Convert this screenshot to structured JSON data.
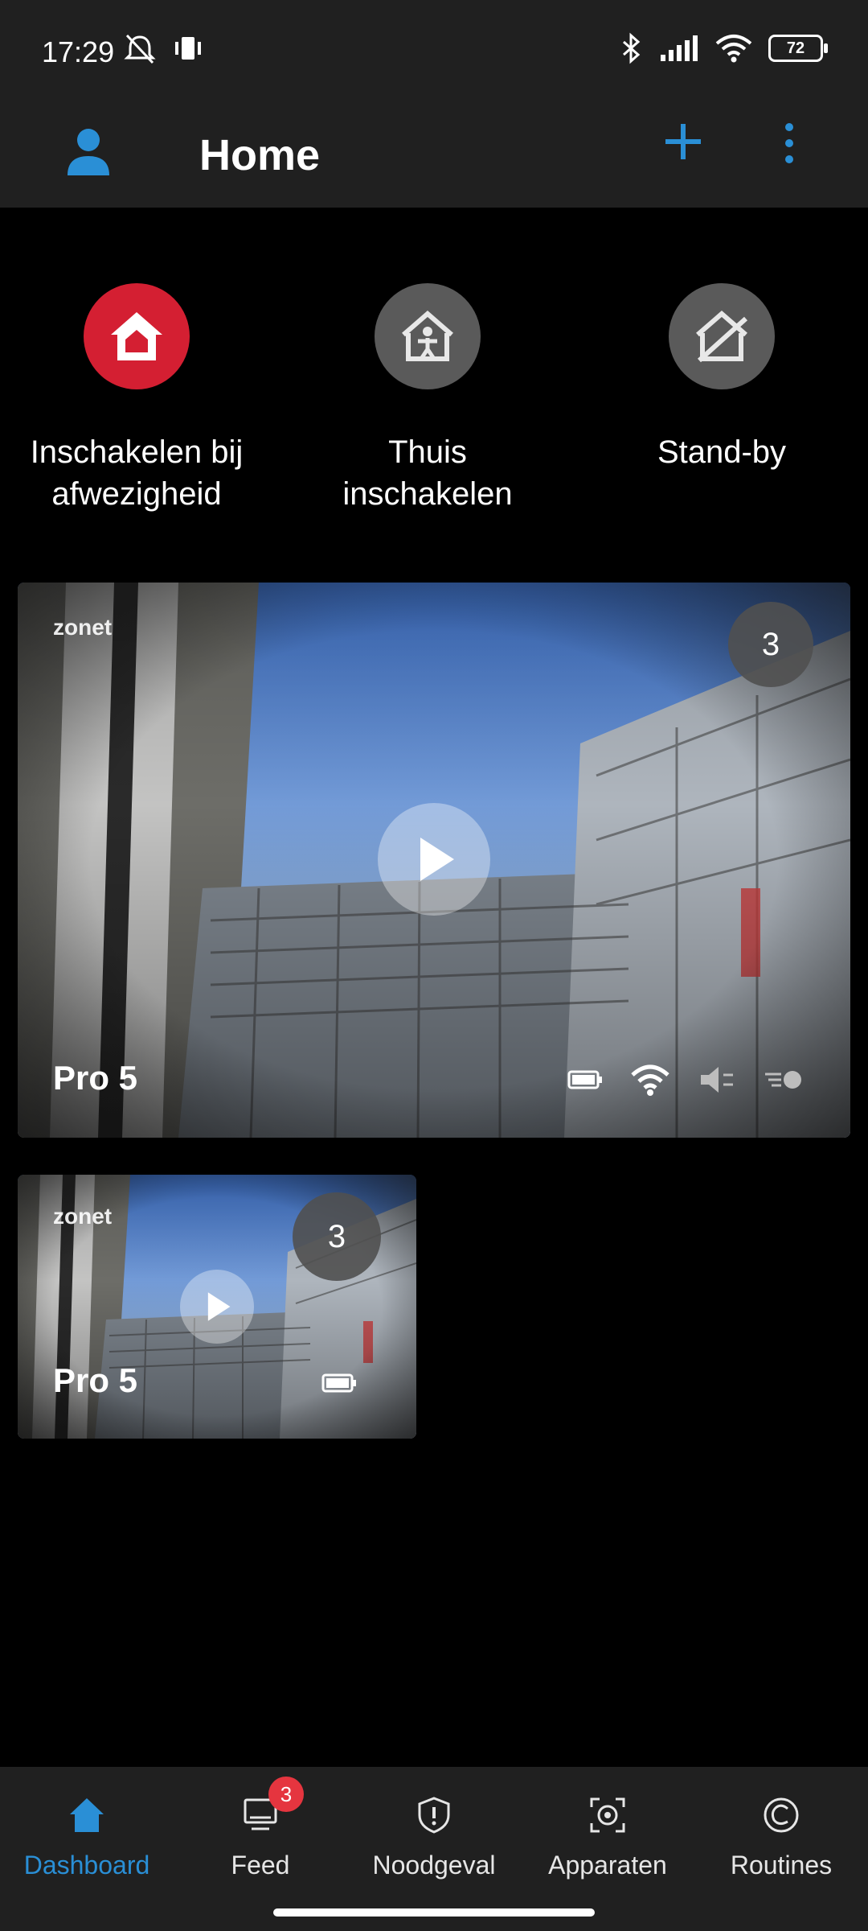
{
  "status_bar": {
    "time": "17:29",
    "battery": "72"
  },
  "app_bar": {
    "title": "Home"
  },
  "modes": [
    {
      "label_line1": "Inschakelen bij",
      "label_line2": "afwezigheid",
      "color": "#d41f32",
      "icon": "house-icon"
    },
    {
      "label_line1": "Thuis",
      "label_line2": "inschakelen",
      "color": "#5a5a5a",
      "icon": "house-person-icon"
    },
    {
      "label_line1": "Stand-by",
      "label_line2": "",
      "color": "#5a5a5a",
      "icon": "house-off-icon"
    }
  ],
  "cameras": [
    {
      "name": "Pro 5",
      "zone": "zonet",
      "badge": "3"
    },
    {
      "name": "Pro 5",
      "zone": "zonet",
      "badge": "3"
    }
  ],
  "bottom_nav": {
    "items": [
      {
        "label": "Dashboard",
        "icon": "home-icon",
        "active": true
      },
      {
        "label": "Feed",
        "icon": "feed-icon",
        "badge": "3"
      },
      {
        "label": "Noodgeval",
        "icon": "shield-alert-icon"
      },
      {
        "label": "Apparaten",
        "icon": "camera-device-icon"
      },
      {
        "label": "Routines",
        "icon": "routines-icon"
      }
    ]
  },
  "colors": {
    "accent": "#2a8fd6",
    "arm_away": "#d41f32",
    "badge": "#e5353f",
    "bar_bg": "#202020"
  }
}
